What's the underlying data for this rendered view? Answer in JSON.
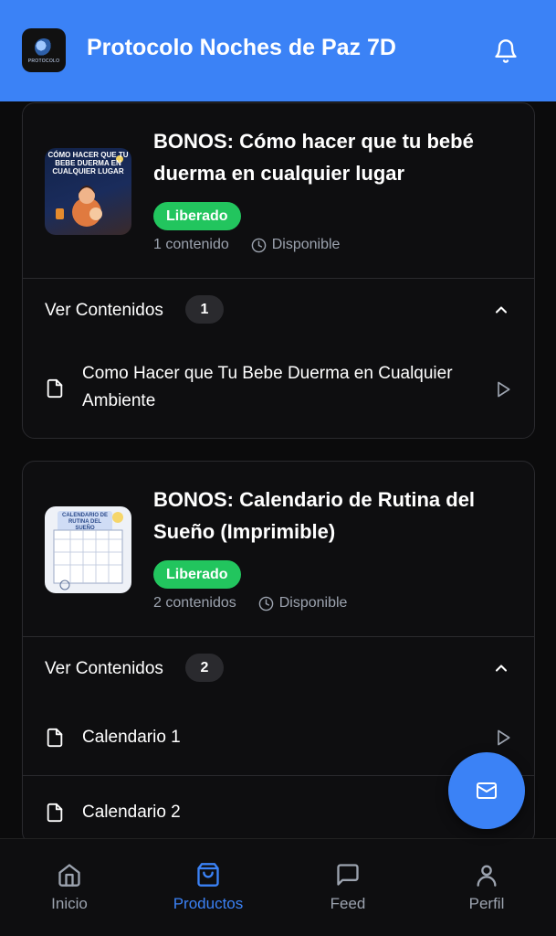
{
  "header": {
    "logo_text": "PROTOCOLO",
    "title": "Protocolo Noches de Paz 7D"
  },
  "products": [
    {
      "title": "BONOS: Cómo hacer que tu bebé duerma en cualquier lugar",
      "thumb_text": "CÓMO HACER QUE TU BEBE DUERMA EN CUALQUIER LUGAR",
      "badge": "Liberado",
      "content_count": "1 contenido",
      "availability": "Disponible",
      "contents_label": "Ver Contenidos",
      "contents_badge": "1",
      "items": [
        {
          "label": "Como Hacer que Tu Bebe Duerma en Cualquier Ambiente"
        }
      ]
    },
    {
      "title": "BONOS: Calendario de Rutina del Sueño (Imprimible)",
      "thumb_text": "CALENDARIO DE RUTINA DEL SUEÑO",
      "badge": "Liberado",
      "content_count": "2 contenidos",
      "availability": "Disponible",
      "contents_label": "Ver Contenidos",
      "contents_badge": "2",
      "items": [
        {
          "label": "Calendario 1"
        },
        {
          "label": "Calendario 2"
        }
      ]
    }
  ],
  "nav": [
    {
      "label": "Inicio",
      "icon": "home-icon"
    },
    {
      "label": "Productos",
      "icon": "shopping-bag-icon",
      "active": true
    },
    {
      "label": "Feed",
      "icon": "message-square-icon"
    },
    {
      "label": "Perfil",
      "icon": "user-icon"
    }
  ],
  "colors": {
    "primary": "#3b82f6",
    "success": "#22c55e",
    "background": "#0b0b0c",
    "muted_text": "#9ca3af"
  }
}
